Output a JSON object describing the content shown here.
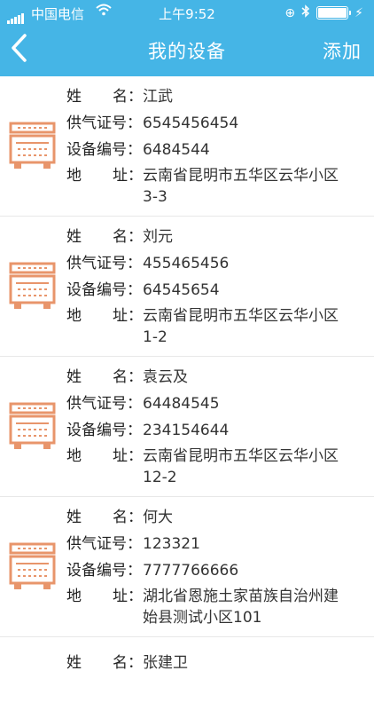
{
  "status_bar": {
    "carrier": "中国电信",
    "time": "上午9:52"
  },
  "nav": {
    "title": "我的设备",
    "add_label": "添加"
  },
  "labels": {
    "name_a": "姓",
    "name_b": "名",
    "colon": "：",
    "gas_cert": "供气证号：",
    "device_no": "设备编号：",
    "addr_a": "地",
    "addr_b": "址"
  },
  "devices": [
    {
      "name": "江武",
      "gas_cert": "6545456454",
      "device_no": "6484544",
      "address": "云南省昆明市五华区云华小区3-3"
    },
    {
      "name": "刘元",
      "gas_cert": "455465456",
      "device_no": "64545654",
      "address": "云南省昆明市五华区云华小区1-2"
    },
    {
      "name": "袁云及",
      "gas_cert": "64484545",
      "device_no": "234154644",
      "address": "云南省昆明市五华区云华小区12-2"
    },
    {
      "name": "何大",
      "gas_cert": "123321",
      "device_no": "7777766666",
      "address": "湖北省恩施土家苗族自治州建始县测试小区101"
    },
    {
      "name": "张建卫"
    }
  ],
  "colors": {
    "header": "#45b5e6",
    "device_icon": "#e8956b"
  },
  "icons": {
    "back": "chevron-left-icon",
    "device": "gas-meter-icon",
    "wifi": "wifi-icon",
    "bluetooth": "bluetooth-icon"
  }
}
